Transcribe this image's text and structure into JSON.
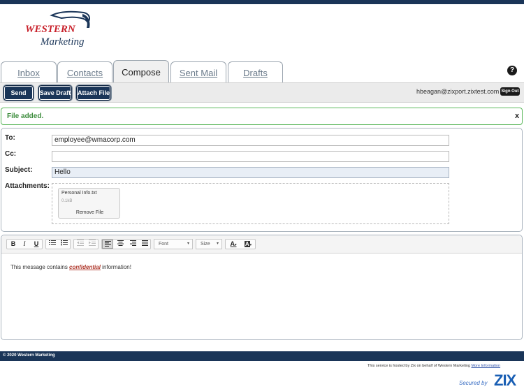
{
  "brand": {
    "line1": "WESTERN",
    "line2": "Marketing"
  },
  "tabs": [
    {
      "label": "Inbox",
      "active": false
    },
    {
      "label": "Contacts",
      "active": false
    },
    {
      "label": "Compose",
      "active": true
    },
    {
      "label": "Sent Mail",
      "active": false
    },
    {
      "label": "Drafts",
      "active": false
    }
  ],
  "help_icon": {
    "glyph": "?",
    "icon": "help-icon"
  },
  "toolbar": {
    "send_label": "Send",
    "save_draft_label": "Save Draft",
    "attach_file_label": "Attach File",
    "user_email": "hbeagan@zixport.zixtest.com",
    "sign_out_label": "Sign Out"
  },
  "alert": {
    "text": "File added.",
    "close": "x"
  },
  "compose": {
    "to_label": "To:",
    "to_value": "employee@wmacorp.com",
    "cc_label": "Cc:",
    "cc_value": "",
    "subject_label": "Subject:",
    "subject_value": "Hello",
    "attachments_label": "Attachments:",
    "attachment": {
      "name": "Personal Info.txt",
      "size": "0.1kB",
      "remove_label": "Remove File"
    }
  },
  "editor": {
    "bold": "B",
    "italic": "I",
    "underline": "U",
    "font_label": "Font",
    "size_label": "Size",
    "text_color": "A",
    "bg_color": "A",
    "message_before": "This message contains ",
    "message_emphasis": "confidential",
    "message_after": " information!"
  },
  "footer": {
    "copyright": "© 2020 Western Marketing",
    "hosted_text": "This service is hosted by Zix on behalf of Western Marketing",
    "more_info": "More Information",
    "secured_by": "Secured by",
    "zix": "ZIX"
  },
  "colors": {
    "navy": "#1a3558",
    "brand_red": "#c8202a",
    "alert_green": "#5cb85c",
    "zix_blue": "#1a5fb4"
  }
}
